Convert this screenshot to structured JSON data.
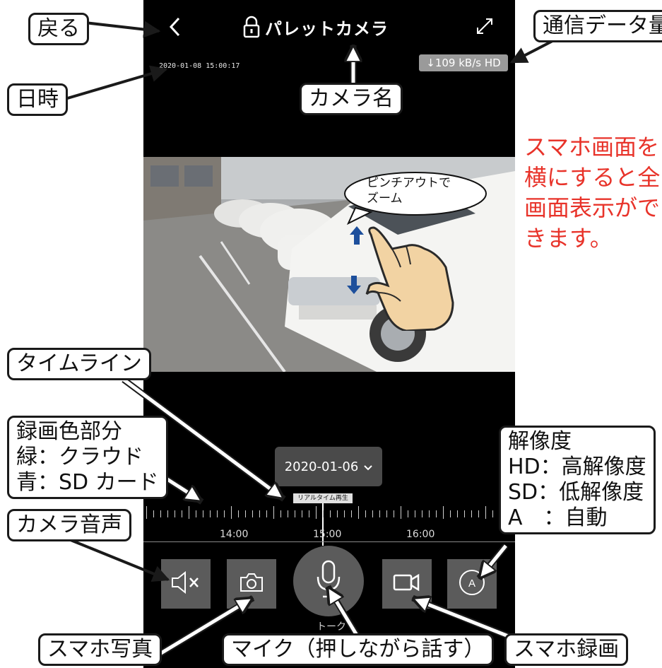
{
  "app": {
    "camera_name": "パレットカメラ",
    "datetime_overlay": "2020-01-08 15:00:17",
    "data_rate": "↓109 kB/s HD"
  },
  "timeline": {
    "date_selector": "2020-01-06",
    "realtime_label": "リアルタイム再生",
    "time_labels": [
      "14:00",
      "15:00",
      "16:00"
    ]
  },
  "controls": {
    "talk_label": "トーク"
  },
  "icons": {
    "back": "chevron-left-icon",
    "lock": "lock-icon",
    "fullscreen": "expand-icon",
    "mute": "speaker-muted-icon",
    "snapshot": "camera-icon",
    "mic": "microphone-icon",
    "record": "video-camera-icon",
    "resolution": "auto-resolution-icon"
  },
  "bubble": {
    "text": "ピンチアウトで\nズーム"
  },
  "note": {
    "text": "スマホ画面を\n横にすると全\n画面表示がで\nきます。",
    "color": "#e8332a"
  },
  "callouts": {
    "back": "戻る",
    "datetime": "日時",
    "camera_name": "カメラ名",
    "data_usage": "通信データ量",
    "timeline": "タイムライン",
    "record_color": "録画色部分\n緑：クラウド\n青：SD カード",
    "camera_audio": "カメラ音声",
    "resolution": "解像度\nHD：高解像度\nSD：低解像度\nA　：自動",
    "phone_photo": "スマホ写真",
    "mic": "マイク（押しながら話す）",
    "phone_record": "スマホ録画"
  },
  "colors": {
    "panel_bg": "#000000",
    "button_bg": "#5b5b5b",
    "date_pill_bg": "#4a4a4a",
    "arrow_blue": "#1d4f9c"
  }
}
